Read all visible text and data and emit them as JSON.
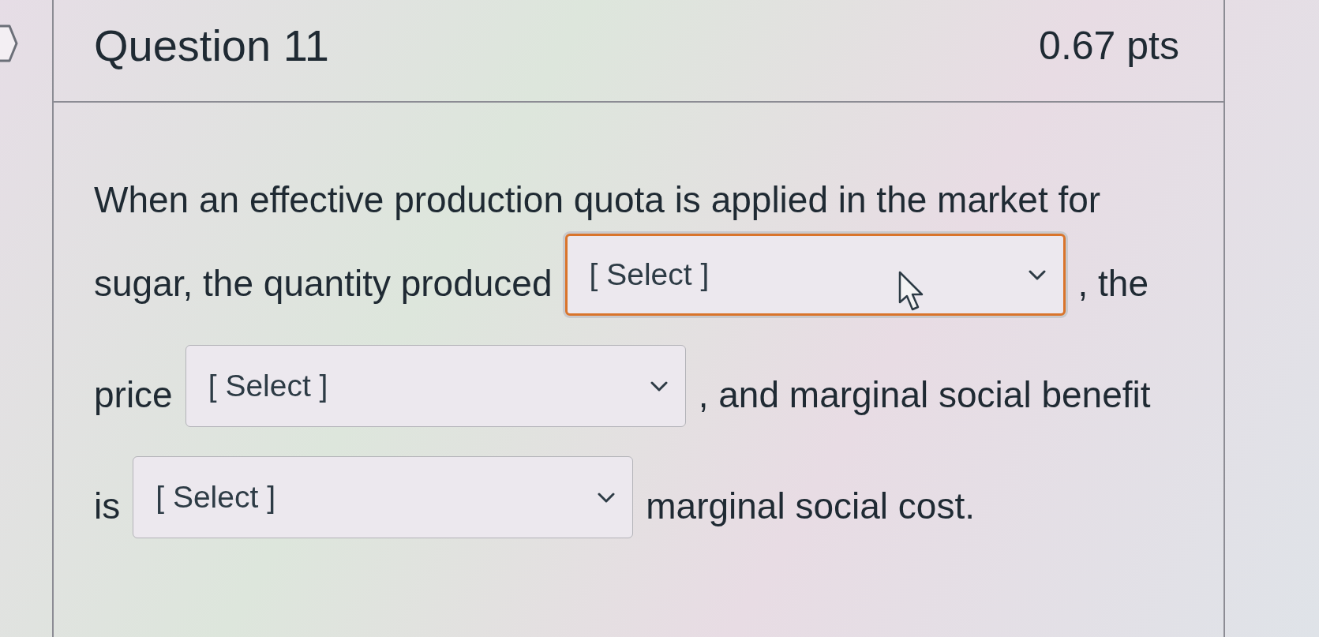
{
  "header": {
    "title": "Question 11",
    "points": "0.67 pts"
  },
  "lines": [
    {
      "segments": [
        {
          "kind": "text",
          "text": "When an effective production quota is applied in the market for"
        }
      ]
    },
    {
      "segments": [
        {
          "kind": "text",
          "text": "sugar, the quantity produced"
        },
        {
          "kind": "select",
          "value": "[ Select ]",
          "focused": true
        },
        {
          "kind": "text",
          "text": ", the"
        }
      ]
    },
    {
      "segments": [
        {
          "kind": "text",
          "text": "price"
        },
        {
          "kind": "select",
          "value": "[ Select ]",
          "focused": false
        },
        {
          "kind": "text",
          "text": ", and marginal social benefit"
        }
      ]
    },
    {
      "segments": [
        {
          "kind": "text",
          "text": "is"
        },
        {
          "kind": "select",
          "value": "[ Select ]",
          "focused": false
        },
        {
          "kind": "text",
          "text": "marginal social cost."
        }
      ]
    }
  ]
}
